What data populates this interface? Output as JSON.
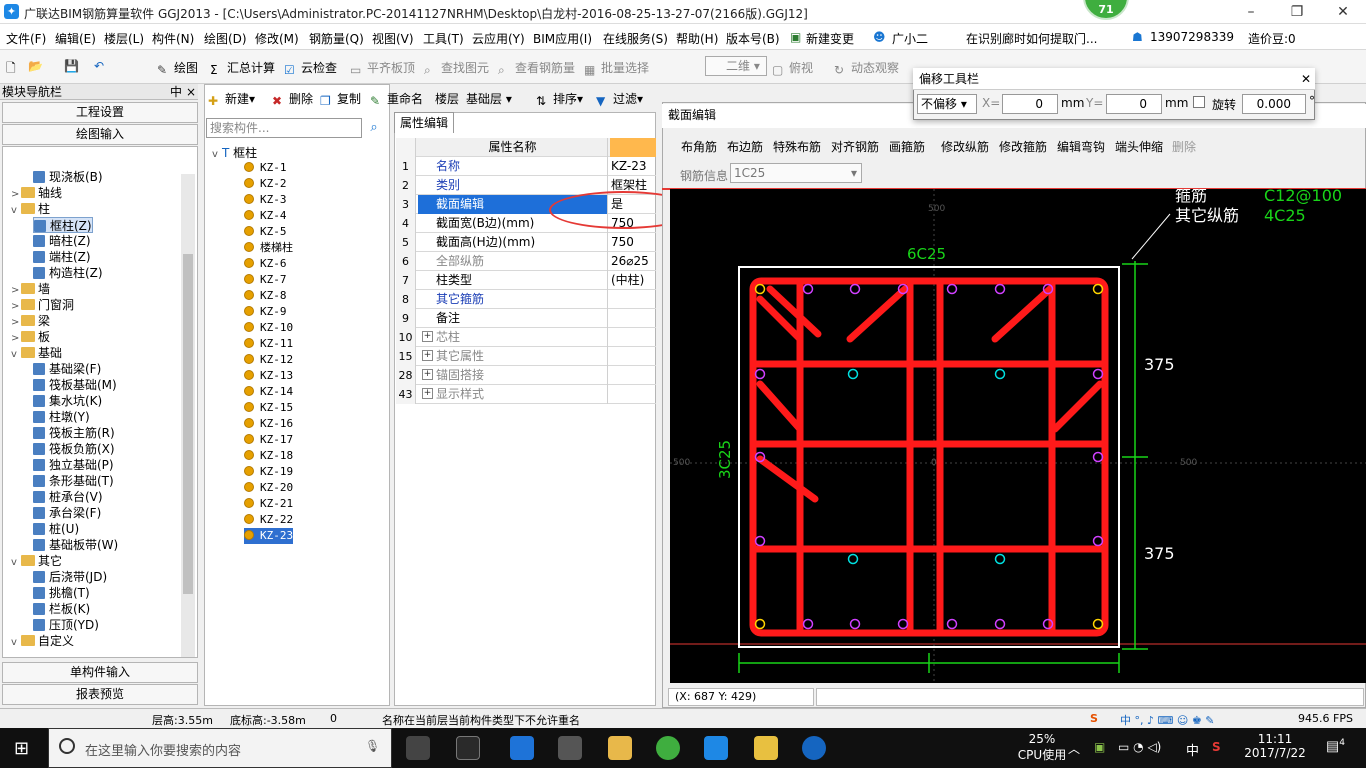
{
  "window": {
    "title": "广联达BIM钢筋算量软件 GGJ2013 - [C:\\Users\\Administrator.PC-20141127NRHM\\Desktop\\白龙村-2016-08-25-13-27-07(2166版).GGJ12]",
    "badge": "71"
  },
  "menu": {
    "items": [
      "文件(F)",
      "编辑(E)",
      "楼层(L)",
      "构件(N)",
      "绘图(D)",
      "修改(M)",
      "钢筋量(Q)",
      "视图(V)",
      "工具(T)",
      "云应用(Y)",
      "BIM应用(I)",
      "在线服务(S)",
      "帮助(H)",
      "版本号(B)",
      "新建变更",
      "广小二"
    ],
    "notice": "在识别廊时如何提取门...",
    "phone": "13907298339",
    "price": "造价豆:0"
  },
  "toolbar": {
    "draw": "绘图",
    "sum": "汇总计算",
    "cloud_check": "云检查",
    "flat_top": "平齐板顶",
    "find": "查找图元",
    "view_rebar": "查看钢筋量",
    "batch": "批量选择",
    "view_mode": "二维",
    "top_view": "俯视",
    "dynamic": "动态观察"
  },
  "nav": {
    "title": "模块导航栏",
    "pin": "中",
    "close": "×",
    "btn_project": "工程设置",
    "btn_draw": "绘图输入",
    "btn_single": "单构件输入",
    "btn_report": "报表预览",
    "tree": [
      {
        "label": "现浇板(B)",
        "type": "leaf",
        "indent": 2
      },
      {
        "label": "轴线",
        "type": "folder",
        "indent": 0,
        "exp": ">"
      },
      {
        "label": "柱",
        "type": "folder",
        "indent": 0,
        "exp": "v"
      },
      {
        "label": "框柱(Z)",
        "type": "leaf",
        "indent": 2,
        "selected": true
      },
      {
        "label": "暗柱(Z)",
        "type": "leaf",
        "indent": 2
      },
      {
        "label": "端柱(Z)",
        "type": "leaf",
        "indent": 2
      },
      {
        "label": "构造柱(Z)",
        "type": "leaf",
        "indent": 2
      },
      {
        "label": "墙",
        "type": "folder",
        "indent": 0,
        "exp": ">"
      },
      {
        "label": "门窗洞",
        "type": "folder",
        "indent": 0,
        "exp": ">"
      },
      {
        "label": "梁",
        "type": "folder",
        "indent": 0,
        "exp": ">"
      },
      {
        "label": "板",
        "type": "folder",
        "indent": 0,
        "exp": ">"
      },
      {
        "label": "基础",
        "type": "folder",
        "indent": 0,
        "exp": "v"
      },
      {
        "label": "基础梁(F)",
        "type": "leaf",
        "indent": 2
      },
      {
        "label": "筏板基础(M)",
        "type": "leaf",
        "indent": 2
      },
      {
        "label": "集水坑(K)",
        "type": "leaf",
        "indent": 2
      },
      {
        "label": "柱墩(Y)",
        "type": "leaf",
        "indent": 2
      },
      {
        "label": "筏板主筋(R)",
        "type": "leaf",
        "indent": 2
      },
      {
        "label": "筏板负筋(X)",
        "type": "leaf",
        "indent": 2
      },
      {
        "label": "独立基础(P)",
        "type": "leaf",
        "indent": 2
      },
      {
        "label": "条形基础(T)",
        "type": "leaf",
        "indent": 2
      },
      {
        "label": "桩承台(V)",
        "type": "leaf",
        "indent": 2
      },
      {
        "label": "承台梁(F)",
        "type": "leaf",
        "indent": 2
      },
      {
        "label": "桩(U)",
        "type": "leaf",
        "indent": 2
      },
      {
        "label": "基础板带(W)",
        "type": "leaf",
        "indent": 2
      },
      {
        "label": "其它",
        "type": "folder",
        "indent": 0,
        "exp": "v"
      },
      {
        "label": "后浇带(JD)",
        "type": "leaf",
        "indent": 2
      },
      {
        "label": "挑檐(T)",
        "type": "leaf",
        "indent": 2
      },
      {
        "label": "栏板(K)",
        "type": "leaf",
        "indent": 2
      },
      {
        "label": "压顶(YD)",
        "type": "leaf",
        "indent": 2
      },
      {
        "label": "自定义",
        "type": "folder",
        "indent": 0,
        "exp": "v"
      }
    ]
  },
  "components": {
    "new": "新建",
    "delete": "删除",
    "copy": "复制",
    "rename": "重命名",
    "floor_label": "楼层",
    "floor": "基础层",
    "sort": "排序",
    "filter": "过滤",
    "search_placeholder": "搜索构件...",
    "root": "框柱",
    "items": [
      "KZ-1",
      "KZ-2",
      "KZ-3",
      "KZ-4",
      "KZ-5",
      "楼梯柱",
      "KZ-6",
      "KZ-7",
      "KZ-8",
      "KZ-9",
      "KZ-10",
      "KZ-11",
      "KZ-12",
      "KZ-13",
      "KZ-14",
      "KZ-15",
      "KZ-16",
      "KZ-17",
      "KZ-18",
      "KZ-19",
      "KZ-20",
      "KZ-21",
      "KZ-22",
      "KZ-23"
    ]
  },
  "props": {
    "tab": "属性编辑",
    "col_name": "属性名称",
    "rows": [
      {
        "n": "1",
        "k": "名称",
        "v": "KZ-23",
        "c": "blue"
      },
      {
        "n": "2",
        "k": "类别",
        "v": "框架柱",
        "c": "blue"
      },
      {
        "n": "3",
        "k": "截面编辑",
        "v": "是",
        "c": "",
        "sel": true
      },
      {
        "n": "4",
        "k": "截面宽(B边)(mm)",
        "v": "750",
        "c": ""
      },
      {
        "n": "5",
        "k": "截面高(H边)(mm)",
        "v": "750",
        "c": ""
      },
      {
        "n": "6",
        "k": "全部纵筋",
        "v": "26⌀25",
        "c": "gray"
      },
      {
        "n": "7",
        "k": "柱类型",
        "v": "(中柱)",
        "c": ""
      },
      {
        "n": "8",
        "k": "其它箍筋",
        "v": "",
        "c": "blue"
      },
      {
        "n": "9",
        "k": "备注",
        "v": "",
        "c": ""
      },
      {
        "n": "10",
        "k": "芯柱",
        "v": "",
        "c": "gray",
        "plus": true
      },
      {
        "n": "15",
        "k": "其它属性",
        "v": "",
        "c": "gray",
        "plus": true
      },
      {
        "n": "28",
        "k": "锚固搭接",
        "v": "",
        "c": "gray",
        "plus": true
      },
      {
        "n": "43",
        "k": "显示样式",
        "v": "",
        "c": "gray",
        "plus": true
      }
    ]
  },
  "section": {
    "title": "截面编辑",
    "tools": [
      "布角筋",
      "布边筋",
      "特殊布筋",
      "对齐钢筋",
      "画箍筋",
      "修改纵筋",
      "修改箍筋",
      "编辑弯钩",
      "端头伸缩",
      "删除"
    ],
    "rebar_label": "钢筋信息",
    "rebar_value": "1C25",
    "labels": {
      "hoop_partial": "箍筋",
      "hoop_value": "C12@100",
      "other_label": "其它纵筋",
      "other_value": "4C25",
      "top": "6C25",
      "left": "3C25",
      "dim1": "375",
      "dim2": "375",
      "t500": "500",
      "l500": "500",
      "r500": "500",
      "zero": "0"
    },
    "coord": "(X: 687 Y: 429)"
  },
  "offset": {
    "title": "偏移工具栏",
    "mode": "不偏移",
    "x_label": "X=",
    "x": "0",
    "unit": "mm",
    "y_label": "Y=",
    "y": "0",
    "rotate": "旋转",
    "angle": "0.000",
    "deg": "°"
  },
  "status": {
    "floor_height": "层高:3.55m",
    "bottom": "底标高:-3.58m",
    "zero": "0",
    "msg": "名称在当前层当前构件类型下不允许重名",
    "fps": "945.6 FPS"
  },
  "taskbar": {
    "search": "在这里输入你要搜索的内容",
    "cpu": "25%",
    "cpu_label": "CPU使用",
    "time": "11:11",
    "date": "2017/7/22",
    "ime": "中",
    "notif": "4"
  }
}
